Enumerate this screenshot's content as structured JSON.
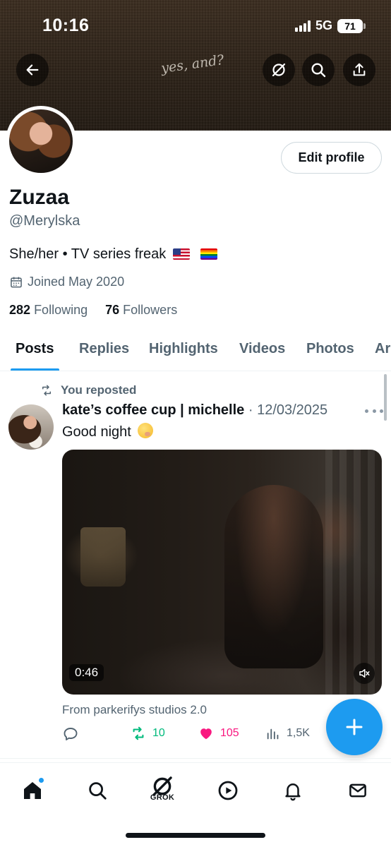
{
  "status_bar": {
    "time": "10:16",
    "network": "5G",
    "battery": "71"
  },
  "banner": {
    "script_text": "yes, and?"
  },
  "profile": {
    "edit_label": "Edit profile",
    "display_name": "Zuzaa",
    "handle": "@Merylska",
    "bio": "She/her • TV series freak",
    "joined": "Joined May 2020",
    "following_count": "282",
    "following_label": "Following",
    "followers_count": "76",
    "followers_label": "Followers"
  },
  "tabs": [
    "Posts",
    "Replies",
    "Highlights",
    "Videos",
    "Photos",
    "Ar"
  ],
  "post": {
    "repost_label": "You reposted",
    "author": "kate’s coffee cup | michelle",
    "date": "· 12/03/2025",
    "text": "Good night",
    "video_duration": "0:46",
    "source": "From parkerifys studios 2.0",
    "reposts": "10",
    "likes": "105",
    "views": "1,5K"
  },
  "nav": {
    "grok_label": "GROK"
  },
  "colors": {
    "accent": "#1d9bf0",
    "repost": "#00ba7c",
    "like": "#f91880",
    "secondary_text": "#536471"
  }
}
